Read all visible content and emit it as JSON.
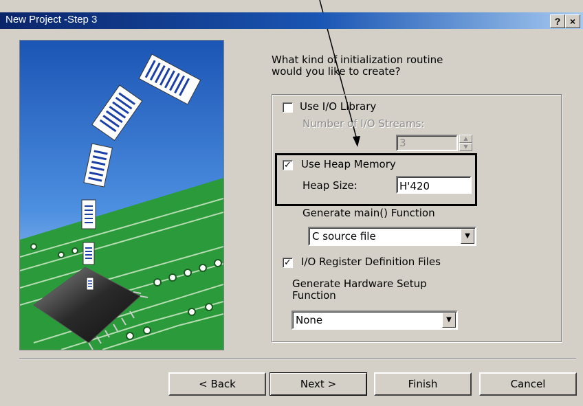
{
  "window": {
    "title": "New Project -Step 3",
    "help_label": "?",
    "close_label": "×"
  },
  "prompt": "What kind of initialization routine\nwould you like to create?",
  "io_library": {
    "label": "Use I/O Library",
    "checked": false,
    "streams_label": "Number of I/O Streams:",
    "streams_value": "3"
  },
  "heap": {
    "label": "Use Heap Memory",
    "checked": true,
    "size_label": "Heap Size:",
    "size_value": "H'420"
  },
  "main_function": {
    "label": "Generate main() Function",
    "selected": "C source file"
  },
  "io_register": {
    "label": "I/O Register Definition Files",
    "checked": true
  },
  "hardware_setup": {
    "label": "Generate Hardware Setup\nFunction",
    "selected": "None"
  },
  "buttons": {
    "back": "< Back",
    "next": "Next >",
    "finish": "Finish",
    "cancel": "Cancel"
  },
  "colors": {
    "title_bar": "#0a246a",
    "dialog_bg": "#d4d0c8",
    "illus_sky": "#1f5fbf",
    "illus_board": "#2a9a3a"
  }
}
